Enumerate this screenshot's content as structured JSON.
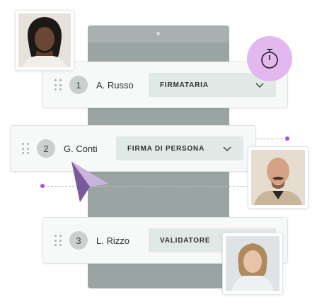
{
  "signers": [
    {
      "number": "1",
      "name": "A. Russo",
      "role": "FIRMATARIA"
    },
    {
      "number": "2",
      "name": "G. Conti",
      "role": "FIRMA DI PERSONA"
    },
    {
      "number": "3",
      "name": "L. Rizzo",
      "role": "VALIDATORE"
    }
  ],
  "icons": {
    "timer": "stopwatch-icon",
    "cursor": "pointer-cursor-icon",
    "drag": "drag-handle-icon",
    "chevron": "chevron-down-icon"
  },
  "colors": {
    "accent": "#b04fd8",
    "timer_bg": "#e3b8ef",
    "role_bg": "#e1e9e6",
    "device": "#9aa4a3"
  }
}
